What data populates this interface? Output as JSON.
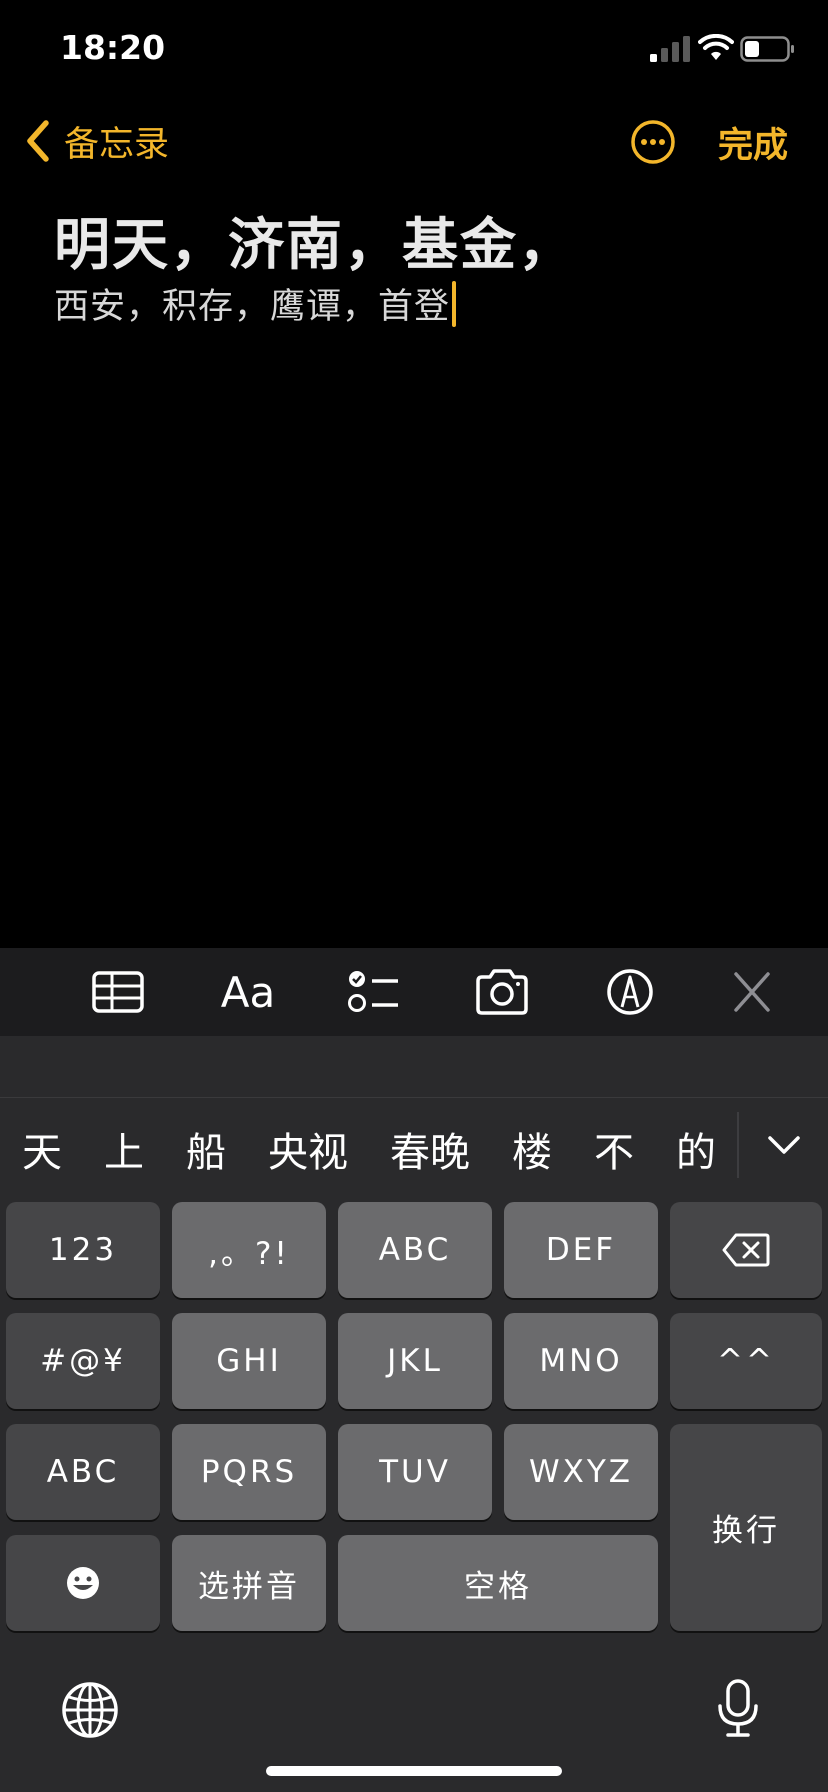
{
  "status_bar": {
    "time": "18:20",
    "signal_icon": "cellular-signal-icon",
    "wifi_icon": "wifi-icon",
    "battery_icon": "battery-icon"
  },
  "nav": {
    "back_label": "备忘录",
    "done_label": "完成",
    "accent_color": "#f3b62b"
  },
  "note": {
    "title": "明天，济南，基金，",
    "body": "西安，积存，鹰谭，首登"
  },
  "toolbar": {
    "items": [
      "table-icon",
      "format-icon",
      "checklist-icon",
      "camera-icon",
      "markup-icon",
      "close-icon"
    ],
    "format_label": "Aa"
  },
  "keyboard": {
    "candidates": [
      "天",
      "上",
      "船",
      "央视",
      "春晚",
      "楼",
      "不",
      "的"
    ],
    "rows": {
      "r1": [
        "123",
        ",。?!",
        "ABC",
        "DEF"
      ],
      "r2": [
        "#@¥",
        "GHI",
        "JKL",
        "MNO",
        "^^"
      ],
      "r3": [
        "ABC",
        "PQRS",
        "TUV",
        "WXYZ"
      ],
      "r4": [
        "选拼音",
        "空格"
      ],
      "return_label": "换行"
    }
  }
}
